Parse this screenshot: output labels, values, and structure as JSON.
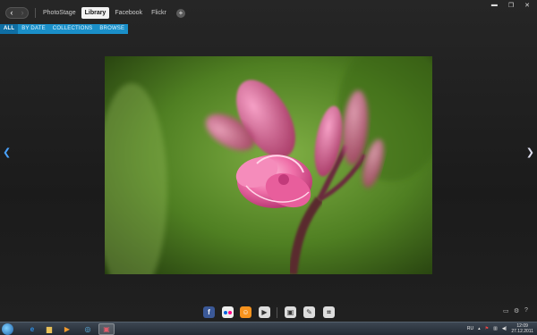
{
  "nav": {
    "back_icon": "chevron-left-icon",
    "forward_icon": "chevron-right-icon"
  },
  "tabs": [
    {
      "label": "PhotoStage",
      "active": false
    },
    {
      "label": "Library",
      "active": true
    },
    {
      "label": "Facebook",
      "active": false
    },
    {
      "label": "Flickr",
      "active": false
    }
  ],
  "add_tab_icon": "plus-icon",
  "window_controls": [
    "minimize-icon",
    "maximize-icon",
    "close-icon"
  ],
  "filters": [
    {
      "label": "ALL",
      "active": true
    },
    {
      "label": "BY DATE",
      "active": false
    },
    {
      "label": "COLLECTIONS",
      "active": false
    },
    {
      "label": "BROWSE",
      "active": false
    }
  ],
  "viewer": {
    "prev_icon": "chevron-left-icon",
    "next_icon": "chevron-right-icon"
  },
  "toolbar": {
    "share_tools": [
      {
        "name": "facebook-icon",
        "glyph": "f",
        "color": "#3b5998"
      },
      {
        "name": "flickr-icon",
        "glyph": "••",
        "color": "#ffffff"
      },
      {
        "name": "odnoklassniki-icon",
        "glyph": "ok",
        "color": "#f7931e"
      },
      {
        "name": "play-icon",
        "glyph": "▶",
        "color": "#dddddd"
      }
    ],
    "edit_tools": [
      {
        "name": "frame-icon",
        "glyph": "▣",
        "color": "#dddddd"
      },
      {
        "name": "pencil-icon",
        "glyph": "✎",
        "color": "#dddddd"
      },
      {
        "name": "crop-icon",
        "glyph": "⌗",
        "color": "#dddddd"
      }
    ]
  },
  "taskbar": {
    "language": "RU",
    "time": "12:09",
    "date": "27.12.2011",
    "apps": [
      "ie-icon",
      "explorer-icon",
      "media-player-icon",
      "messenger-icon",
      "photo-app-icon"
    ]
  },
  "colors": {
    "accent": "#1a8fc8",
    "accent_active": "#0f6ea3"
  }
}
